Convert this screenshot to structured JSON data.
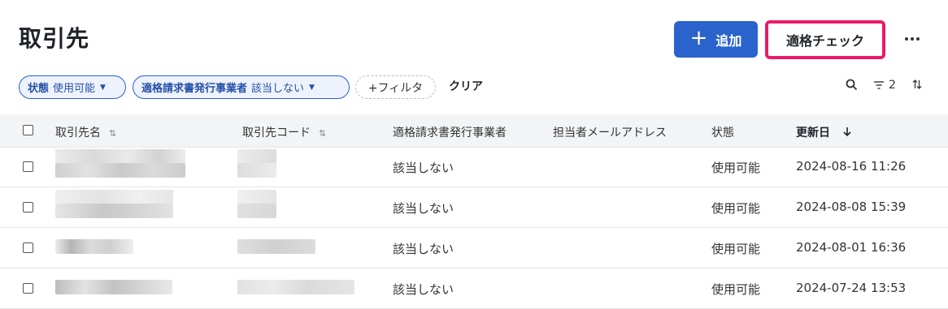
{
  "page": {
    "title": "取引先"
  },
  "actions": {
    "add_label": "追加",
    "check_label": "適格チェック"
  },
  "filters": {
    "chip1": {
      "key": "状態",
      "value": "使用可能"
    },
    "chip2": {
      "key": "適格請求書発行事業者",
      "value": "該当しない"
    },
    "add_filter_label": "+フィルタ",
    "clear_label": "クリア",
    "filter_count": "2"
  },
  "table": {
    "headers": {
      "name": "取引先名",
      "code": "取引先コード",
      "qualified": "適格請求書発行事業者",
      "email": "担当者メールアドレス",
      "status": "状態",
      "updated": "更新日"
    },
    "rows": [
      {
        "qualified": "該当しない",
        "status": "使用可能",
        "updated": "2024-08-16 11:26"
      },
      {
        "qualified": "該当しない",
        "status": "使用可能",
        "updated": "2024-08-08 15:39"
      },
      {
        "qualified": "該当しない",
        "status": "使用可能",
        "updated": "2024-08-01 16:36"
      },
      {
        "qualified": "該当しない",
        "status": "使用可能",
        "updated": "2024-07-24 13:53"
      }
    ]
  },
  "colors": {
    "primary": "#2b63cc",
    "highlight": "#ea1a6a"
  },
  "icons": [
    "plus-icon",
    "more-icon",
    "caret-down-icon",
    "search-icon",
    "filter-icon",
    "sort-icon",
    "arrow-down-icon"
  ]
}
